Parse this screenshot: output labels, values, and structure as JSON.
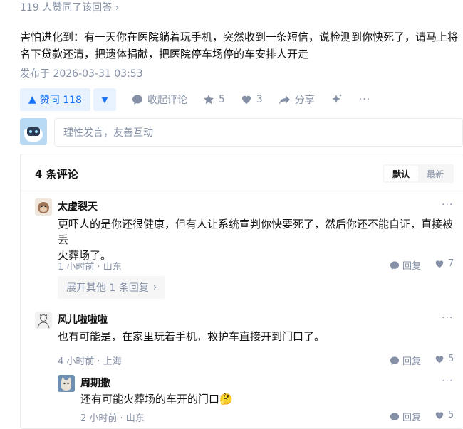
{
  "answer_meta": {
    "votes_line": "119 人赞同了该回答",
    "body": "害怕进化到：有一天你在医院躺着玩手机，突然收到一条短信，说检测到你快死了，请马上将名下贷款还清，把遗体捐献，把医院停车场停的车安排人开走",
    "published": "发布于 2026-03-31 03:53"
  },
  "actions": {
    "vote_up_label": "赞同 118",
    "collapse_label": "收起评论",
    "favorites_count": "5",
    "likes_count": "3",
    "share_label": "分享"
  },
  "comment_input": {
    "placeholder": "理性发言，友善互动"
  },
  "comments_panel": {
    "count_label": "4 条评论",
    "sort_default": "默认",
    "sort_latest": "最新"
  },
  "comments": [
    {
      "author": "太虚裂天",
      "text_line1": "更吓人的是你还很健康，但有人让系统宣判你快要死了，然后你还不能自证，直接被丢",
      "text_line2": "火葬场了。",
      "meta": "1 小时前 · 山东",
      "reply_label": "回复",
      "likes": "7",
      "expand_label": "展开其他 1 条回复"
    },
    {
      "author": "风儿啦啦啦",
      "text": "也有可能是，在家里玩着手机，救护车直接开到门口了。",
      "meta": "4 小时前 · 上海",
      "reply_label": "回复",
      "likes": "5"
    },
    {
      "author": "周期撒",
      "text": "还有可能火葬场的车开的门口🤔",
      "meta": "2 小时前 · 山东",
      "reply_label": "回复",
      "likes": "5"
    }
  ],
  "colors": {
    "accent": "#1772f6",
    "accent_bg": "#e8f1fe",
    "muted": "#8590a6"
  }
}
